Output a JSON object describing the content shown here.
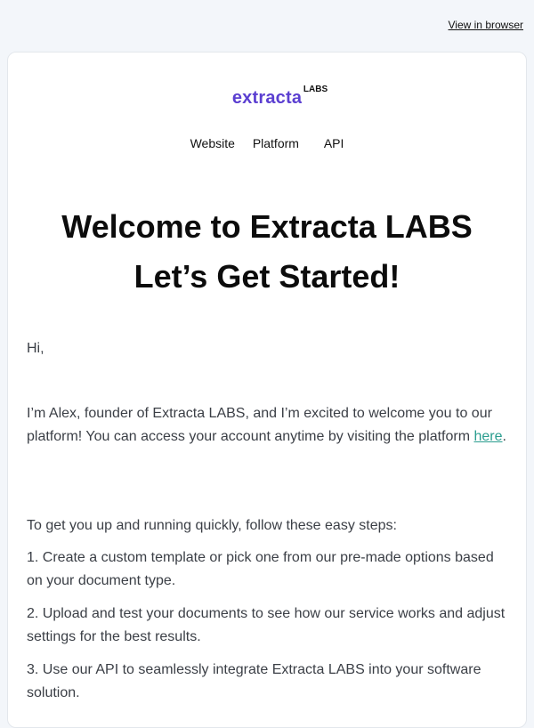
{
  "header": {
    "view_in_browser": "View in browser"
  },
  "logo": {
    "word": "extracta",
    "labs": "LABS"
  },
  "nav": {
    "items": [
      "Website",
      "Platform",
      "API"
    ]
  },
  "title": {
    "line1": "Welcome to Extracta LABS",
    "line2": "Let’s Get Started!"
  },
  "content": {
    "greeting": "Hi,",
    "intro_before_link": "I’m Alex, founder of Extracta LABS, and I’m excited to welcome you to our platform! You can access your account anytime by visiting the platform ",
    "intro_link": "here",
    "intro_after_link": ".",
    "steps_intro": "To get you up and running quickly, follow these easy steps:",
    "steps": [
      "1. Create a custom template or pick one from our pre-made options based on your document type.",
      "2. Upload and test your documents to see how our service works and adjust settings for the best results.",
      "3. Use our API to seamlessly integrate Extracta LABS into your software solution."
    ]
  },
  "colors": {
    "brand": "#5b3fd1",
    "link": "#2a9d8f",
    "background": "#f3f6fa"
  }
}
